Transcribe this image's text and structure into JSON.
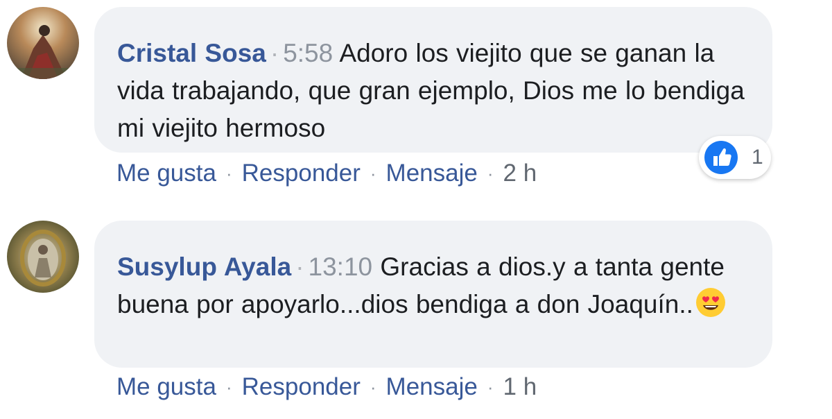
{
  "comments": [
    {
      "author": "Cristal Sosa",
      "timestamp": "5:58",
      "text": "Adoro los viejito que se ganan la vida trabajando, que gran ejemplo, Dios me lo bendiga mi viejito hermoso",
      "actions": {
        "like": "Me gusta",
        "reply": "Responder",
        "message": "Mensaje",
        "age": "2 h"
      },
      "reaction": {
        "icon": "like-icon",
        "count": "1",
        "color": "#1877f2"
      }
    },
    {
      "author": "Susylup Ayala",
      "timestamp": "13:10",
      "text": "Gracias a dios.y a tanta gente buena por apoyarlo...dios bendiga a don Joaquín..",
      "emoji": "heart-eyes-emoji",
      "actions": {
        "like": "Me gusta",
        "reply": "Responder",
        "message": "Mensaje",
        "age": "1 h"
      }
    }
  ],
  "separator": "·",
  "colors": {
    "author": "#385898",
    "bubble": "#f0f2f5",
    "timestamp": "#8d949e",
    "text": "#1c1e21"
  }
}
